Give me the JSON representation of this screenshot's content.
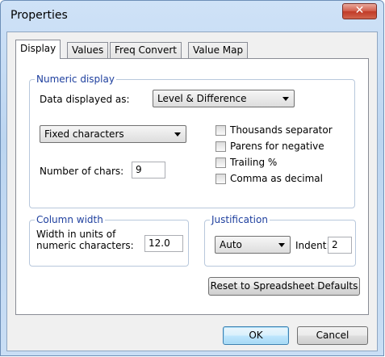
{
  "window": {
    "title": "Properties",
    "close_glyph": "✕"
  },
  "tabs": [
    {
      "label": "Display",
      "active": true
    },
    {
      "label": "Values",
      "active": false
    },
    {
      "label": "Freq Convert",
      "active": false
    },
    {
      "label": "Value Map",
      "active": false
    }
  ],
  "numeric_display": {
    "legend": "Numeric display",
    "data_displayed_label": "Data displayed as:",
    "data_displayed_value": "Level & Difference",
    "format_value": "Fixed characters",
    "num_chars_label": "Number of chars:",
    "num_chars_value": "9",
    "checkboxes": [
      {
        "label": "Thousands separator",
        "checked": false
      },
      {
        "label": "Parens for negative",
        "checked": false
      },
      {
        "label": "Trailing %",
        "checked": false
      },
      {
        "label": "Comma as decimal",
        "checked": false
      }
    ]
  },
  "column_width": {
    "legend": "Column width",
    "label_line1": "Width in units of",
    "label_line2": "numeric characters:",
    "value": "12.0"
  },
  "justification": {
    "legend": "Justification",
    "value": "Auto",
    "indent_label": "Indent:",
    "indent_value": "2"
  },
  "buttons": {
    "reset": "Reset to Spreadsheet Defaults",
    "ok": "OK",
    "cancel": "Cancel"
  }
}
